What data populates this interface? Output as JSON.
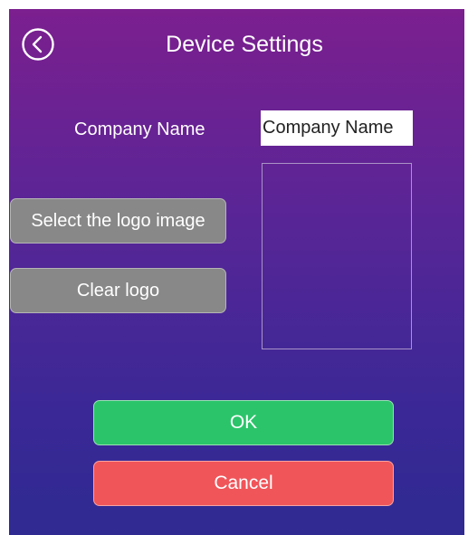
{
  "header": {
    "title": "Device Settings",
    "back_icon": "chevron-left-circle-icon"
  },
  "company": {
    "label": "Company Name",
    "value": "Company Name"
  },
  "logo": {
    "select_label": "Select the logo image",
    "clear_label": "Clear logo"
  },
  "actions": {
    "ok_label": "OK",
    "cancel_label": "Cancel"
  },
  "colors": {
    "gradient_top": "#7c1f8f",
    "gradient_bottom": "#2f2a92",
    "ok": "#2bc46a",
    "cancel": "#f0555a",
    "gray_button": "#888888"
  }
}
